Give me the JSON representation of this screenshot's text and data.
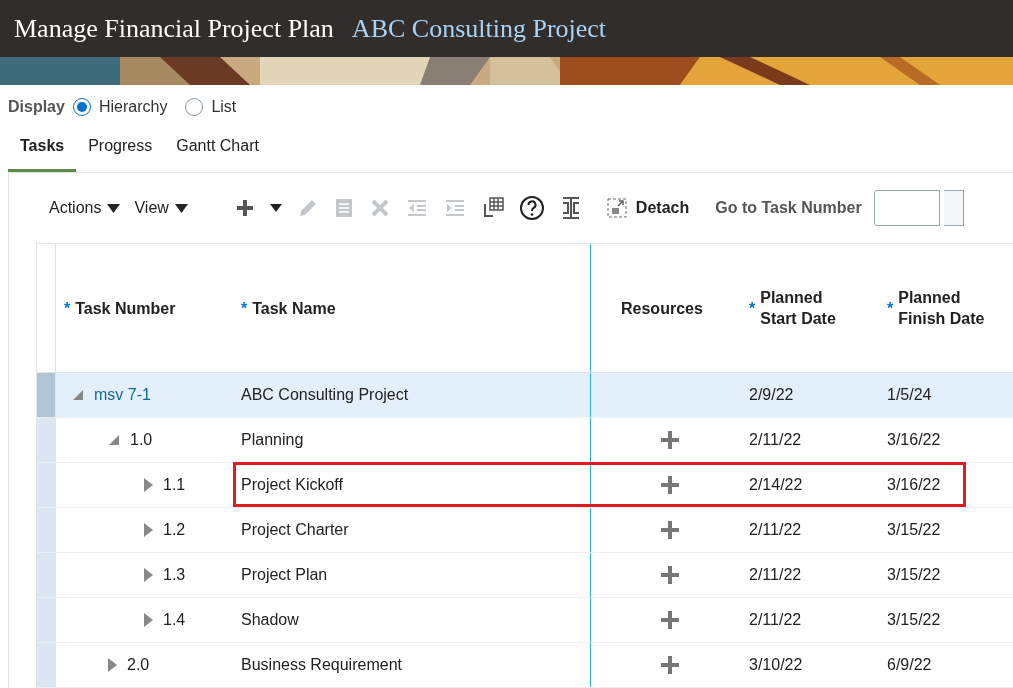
{
  "header": {
    "title": "Manage Financial Project Plan",
    "project": "ABC Consulting Project"
  },
  "display": {
    "label": "Display",
    "options": [
      {
        "label": "Hierarchy",
        "selected": true
      },
      {
        "label": "List",
        "selected": false
      }
    ]
  },
  "tabs": [
    {
      "label": "Tasks",
      "selected": true
    },
    {
      "label": "Progress",
      "selected": false
    },
    {
      "label": "Gantt Chart",
      "selected": false
    }
  ],
  "toolbar": {
    "menus": [
      "Actions",
      "View"
    ],
    "tools": [
      {
        "kind": "add",
        "disabled": false
      },
      {
        "kind": "caret",
        "disabled": false
      },
      {
        "kind": "edit",
        "disabled": true
      },
      {
        "kind": "copy",
        "disabled": true
      },
      {
        "kind": "delete",
        "disabled": true
      },
      {
        "kind": "outdent",
        "disabled": true
      },
      {
        "kind": "indent",
        "disabled": true
      },
      {
        "kind": "grid",
        "disabled": false
      },
      {
        "kind": "help",
        "disabled": false
      },
      {
        "kind": "columns",
        "disabled": false
      }
    ],
    "detach": "Detach",
    "goto_label": "Go to Task Number"
  },
  "table": {
    "columns": [
      {
        "marker": "*",
        "label": "Task Number"
      },
      {
        "marker": "*",
        "label": "Task Name"
      },
      {
        "label": "Resources"
      },
      {
        "marker": "*",
        "label": "Planned Start Date"
      },
      {
        "marker": "*",
        "label": "Planned Finish Date"
      }
    ],
    "rows": [
      {
        "number": "msv 7-1",
        "name": "ABC Consulting Project",
        "add_resource": false,
        "start": "2/9/22",
        "finish": "1/5/24",
        "expanded": true,
        "selected": true,
        "outlined": false,
        "children": [
          {
            "number": "1.0",
            "name": "Planning",
            "add_resource": true,
            "start": "2/11/22",
            "finish": "3/16/22",
            "expanded": true,
            "selected": false,
            "outlined": false,
            "children": [
              {
                "number": "1.1",
                "name": "Project Kickoff",
                "add_resource": true,
                "start": "2/14/22",
                "finish": "3/16/22",
                "expanded": false,
                "selected": false,
                "outlined": true
              },
              {
                "number": "1.2",
                "name": "Project Charter",
                "add_resource": true,
                "start": "2/11/22",
                "finish": "3/15/22",
                "expanded": false,
                "selected": false,
                "outlined": false
              },
              {
                "number": "1.3",
                "name": "Project Plan",
                "add_resource": true,
                "start": "2/11/22",
                "finish": "3/15/22",
                "expanded": false,
                "selected": false,
                "outlined": false
              },
              {
                "number": "1.4",
                "name": "Shadow",
                "add_resource": true,
                "start": "2/11/22",
                "finish": "3/15/22",
                "expanded": false,
                "selected": false,
                "outlined": false
              }
            ]
          },
          {
            "number": "2.0",
            "name": "Business Requirement",
            "add_resource": true,
            "start": "3/10/22",
            "finish": "6/9/22",
            "expanded": false,
            "selected": false,
            "outlined": false
          }
        ]
      }
    ]
  }
}
